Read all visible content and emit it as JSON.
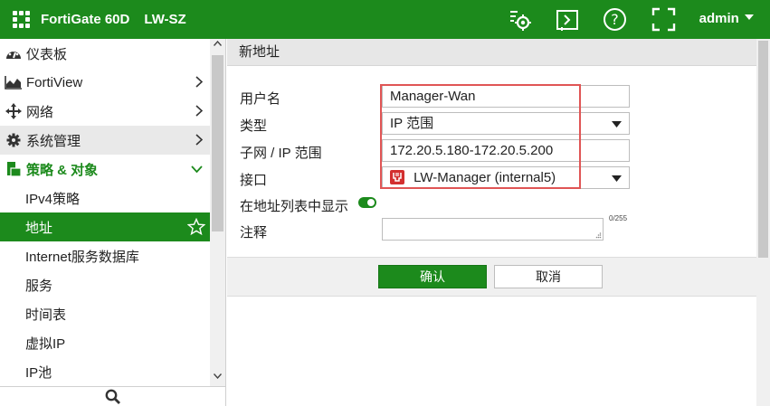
{
  "topbar": {
    "product": "FortiGate 60D",
    "hostname": "LW-SZ",
    "user": "admin",
    "icons": [
      "cli-console-icon",
      "presentation-icon",
      "help-icon",
      "fullscreen-icon"
    ]
  },
  "sidebar": {
    "items": [
      {
        "label": "仪表板",
        "icon": "dashboard-icon"
      },
      {
        "label": "FortiView",
        "icon": "chart-area-icon"
      },
      {
        "label": "网络",
        "icon": "arrows-move-icon"
      },
      {
        "label": "系统管理",
        "icon": "gear-icon"
      },
      {
        "label": "策略 & 对象",
        "icon": "policy-icon"
      }
    ],
    "subitems": [
      {
        "label": "IPv4策略"
      },
      {
        "label": "地址"
      },
      {
        "label": "Internet服务数据库"
      },
      {
        "label": "服务"
      },
      {
        "label": "时间表"
      },
      {
        "label": "虚拟IP"
      },
      {
        "label": "IP池"
      }
    ],
    "search_icon": "search-icon"
  },
  "form": {
    "title": "新地址",
    "fields": {
      "name": {
        "label": "用户名",
        "value": "Manager-Wan"
      },
      "type": {
        "label": "类型",
        "value": "IP 范围"
      },
      "range": {
        "label": "子网 / IP 范围",
        "value": "172.20.5.180-172.20.5.200"
      },
      "interface": {
        "label": "接口",
        "value": "LW-Manager (internal5)"
      },
      "show_in_list": {
        "label": "在地址列表中显示",
        "enabled": true
      },
      "comment": {
        "label": "注释",
        "value": "",
        "counter": "0/255"
      }
    },
    "buttons": {
      "ok": "确认",
      "cancel": "取消"
    }
  },
  "colors": {
    "brand": "#1c8a1c",
    "highlight": "#e05555",
    "interface_icon": "#d32f2f"
  }
}
